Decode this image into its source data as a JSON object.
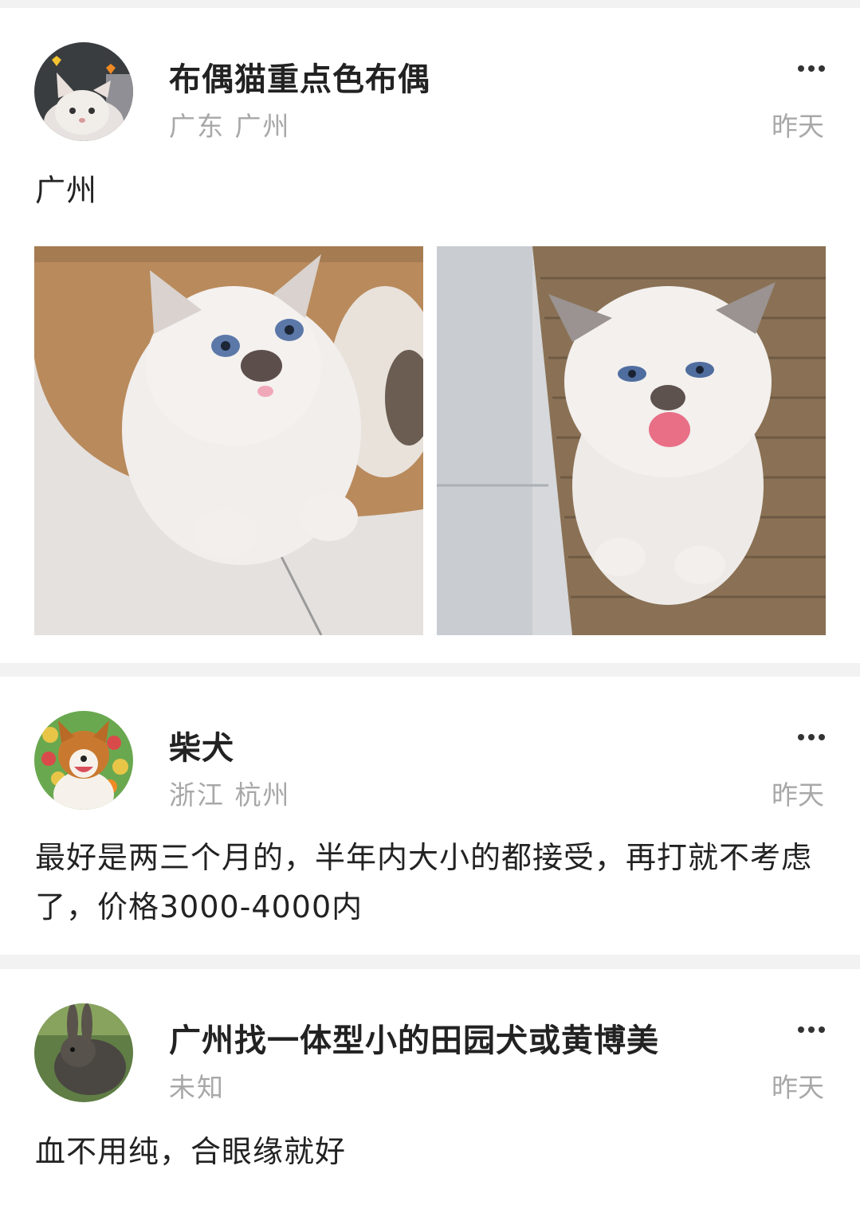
{
  "posts": [
    {
      "name": "布偶猫重点色布偶",
      "location": "广东 广州",
      "time": "昨天",
      "content": "广州",
      "avatar_icon": "cat-avatar",
      "photos": [
        "kitten-photo-lying",
        "kitten-photo-meowing"
      ]
    },
    {
      "name": "柴犬",
      "location": "浙江 杭州",
      "time": "昨天",
      "content": "最好是两三个月的，半年内大小的都接受，再打就不考虑了，价格3000-4000内",
      "avatar_icon": "dog-avatar"
    },
    {
      "name": "广州找一体型小的田园犬或黄博美",
      "location": "未知",
      "time": "昨天",
      "content": "血不用纯，合眼缘就好",
      "avatar_icon": "rabbit-avatar"
    }
  ],
  "more_icon": "more-dots-icon"
}
